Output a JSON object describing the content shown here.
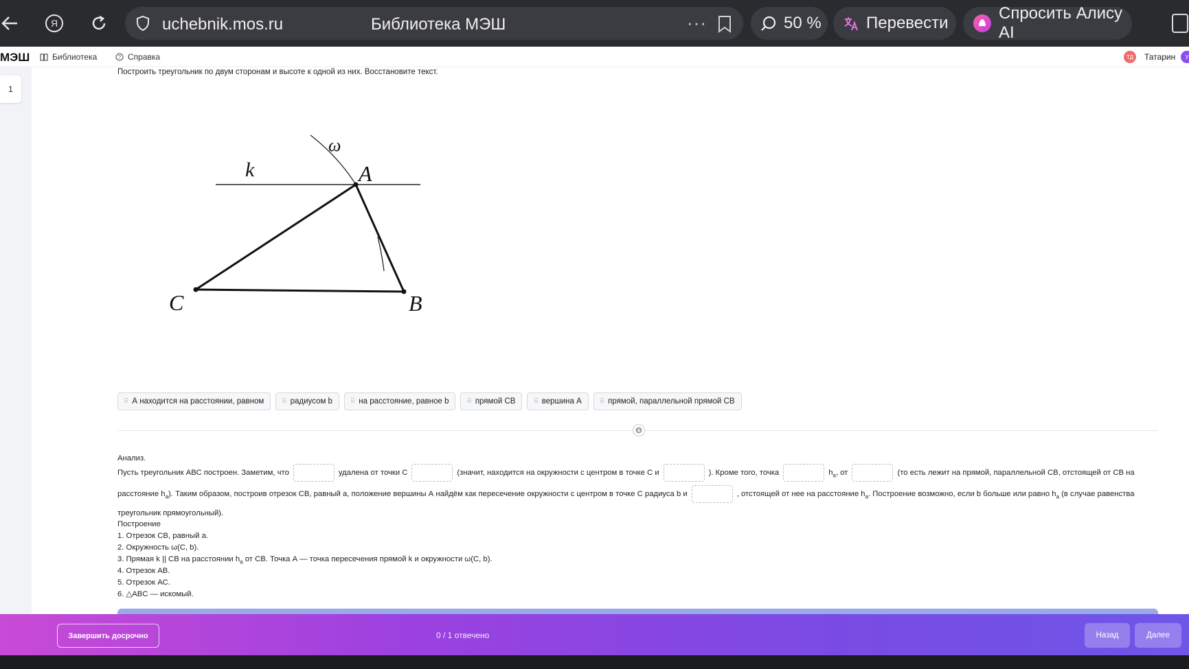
{
  "browser": {
    "url": "uchebnik.mos.ru",
    "tab_title": "Библиотека МЭШ",
    "more": "···",
    "zoom": "50 %",
    "translate": "Перевести",
    "alice": "Спросить Алису AI"
  },
  "header": {
    "brand": "МЭШ",
    "library": "Библиотека",
    "help": "Справка",
    "user_initials": "ТД",
    "user_name": "Татарин",
    "user2_initial": "У"
  },
  "question": {
    "number": "1",
    "task": "Построить треугольник по двум сторонам и высоте к одной из них. Восстановите текст."
  },
  "figure": {
    "labels": {
      "omega": "ω",
      "k": "k",
      "A": "A",
      "B": "B",
      "C": "C"
    }
  },
  "chips": [
    "А находится на расстоянии, равном",
    "радиусом b",
    "на расстояние, равное b",
    "прямой СВ",
    "вершина А",
    "прямой, параллельной прямой СВ"
  ],
  "analysis": {
    "heading": "Анализ.",
    "l1_a": "Пусть треугольник АВС построен. Заметим, что",
    "l1_b": "удалена от точки С",
    "l1_c": "(значит, находится на окружности с центром в точке С и",
    "l1_d": "). Кроме того, точка",
    "l1_h": "h",
    "l1_hsub": "a",
    "l1_e": ", от",
    "l1_f": "(то есть лежит на прямой, параллельной СВ, отстоящей от СВ на",
    "l2_a": "расстояние h",
    "l2_asub": "a",
    "l2_b": "). Таким образом, построив отрезок СВ, равный a, положение вершины А найдём как пересечение окружности с центром в точке С радиуса b и",
    "l2_c": ", отстоящей от нее на расстояние h",
    "l2_csub": "a",
    "l2_d": ". Построение возможно, если b больше или равно h",
    "l2_dsub": "a",
    "l2_e": " (в случае равенства",
    "l3": "треугольник прямоугольный).",
    "construction_heading": "Построение",
    "steps": [
      "1. Отрезок  СВ, равный a.",
      "2. Окружность ω(С, b).",
      "3. Прямая  k || СВ на расстоянии h",
      "4. Отрезок АВ.",
      "5. Отрезок АС.",
      "6. △ABC — искомый."
    ],
    "step3_sub": "a",
    "step3_tail": " от СВ. Точка А — точка пересечения прямой k и окружности ω(С, b)."
  },
  "footer": {
    "finish": "Завершить досрочно",
    "progress": "0 / 1 отвечено",
    "back": "Назад",
    "next": "Далее"
  }
}
